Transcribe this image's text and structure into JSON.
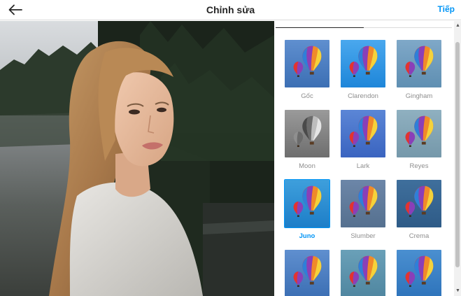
{
  "header": {
    "title": "Chỉnh sửa",
    "next_label": "Tiếp",
    "back_icon": "arrow-left-icon"
  },
  "colors": {
    "accent": "#0095f6",
    "text": "#262626",
    "muted": "#8e8e8e",
    "divider": "#dbdbdb"
  },
  "filters": [
    {
      "label": "Gốc",
      "selected": false
    },
    {
      "label": "Clarendon",
      "selected": false
    },
    {
      "label": "Gingham",
      "selected": false
    },
    {
      "label": "Moon",
      "selected": false
    },
    {
      "label": "Lark",
      "selected": false
    },
    {
      "label": "Reyes",
      "selected": false
    },
    {
      "label": "Juno",
      "selected": true
    },
    {
      "label": "Slumber",
      "selected": false
    },
    {
      "label": "Crema",
      "selected": false
    },
    {
      "label": "",
      "selected": false
    },
    {
      "label": "",
      "selected": false
    },
    {
      "label": "",
      "selected": false
    }
  ]
}
